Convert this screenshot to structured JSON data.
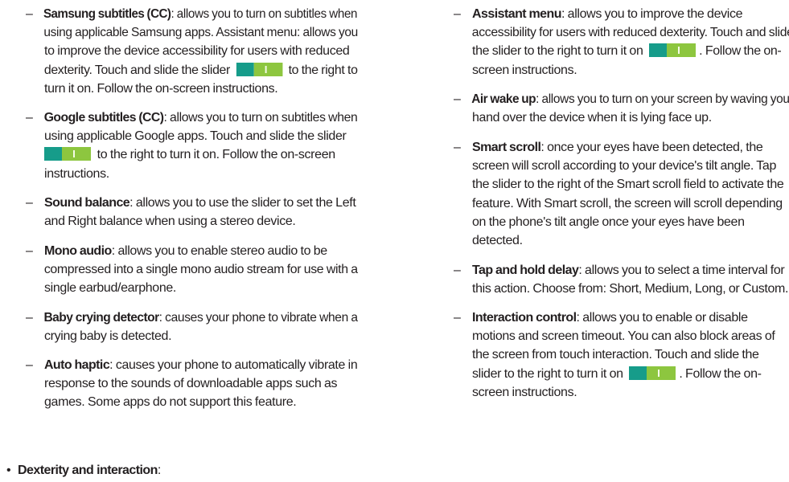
{
  "left": {
    "samsung": {
      "term": "Samsung subtitles (CC)",
      "l1_rest": ": allows you to turn on subtitles when",
      "l2": "using applicable Samsung apps. Assistant menu: allows you",
      "l3": "to improve the device accessibility for users with reduced",
      "l4_a": "dexterity. Touch and slide the slider",
      "l4_b": "to the right to",
      "l5": "turn it on. Follow the on-screen instructions."
    },
    "google": {
      "term": "Google subtitles (CC)",
      "l1_rest": ": allows you to turn on subtitles when",
      "l2": "using applicable Google apps. Touch and slide the slider",
      "l3_b": "to the right to turn it on. Follow the on-screen",
      "l4": "instructions."
    },
    "sound": {
      "term": "Sound balance",
      "l1_rest": ": allows you to use the slider to set the Left",
      "l2": "and Right balance when using a stereo device."
    },
    "mono": {
      "term": "Mono audio",
      "l1_rest": ": allows you to enable stereo audio to be",
      "l2": "compressed into a single mono audio stream for use with a",
      "l3": "single earbud/earphone."
    },
    "baby": {
      "term": "Baby crying detector",
      "l1_rest": ": causes your phone to vibrate when a",
      "l2": "crying baby is detected."
    },
    "haptic": {
      "term": "Auto haptic",
      "l1_rest": ": causes your phone to automatically vibrate in",
      "l2": "response to the sounds of downloadable apps such as",
      "l3": "games. Some apps do not support this feature."
    },
    "dexterity": {
      "bullet": "•",
      "term": "Dexterity and interaction",
      "rest": ":"
    }
  },
  "right": {
    "assistant": {
      "term": "Assistant menu",
      "l1_rest": ": allows you to improve the device",
      "l2": "accessibility for users with reduced dexterity. Touch and slide",
      "l3_a": "the slider to the right to turn it on",
      "l3_b": ". Follow the on-",
      "l4": "screen instructions."
    },
    "airwake": {
      "term": "Air wake up",
      "l1_rest": ": allows you to turn on your screen by waving your",
      "l2": "hand over the device when it is lying face up."
    },
    "smart": {
      "term": "Smart scroll",
      "l1_rest": ": once your eyes have been detected, the",
      "l2": "screen will scroll according to your device's tilt angle. Tap",
      "l3": "the slider to the right of the Smart scroll field to activate the",
      "l4": "feature. With Smart scroll, the screen will scroll depending",
      "l5": "on the phone's tilt angle once your eyes have been",
      "l6": "detected."
    },
    "taphold": {
      "term": "Tap and hold delay",
      "l1_rest": ": allows you to select a time interval for",
      "l2": "this action. Choose from: Short, Medium, Long, or Custom."
    },
    "interaction": {
      "term": "Interaction control",
      "l1_rest": ": allows you to enable or disable",
      "l2": "motions and screen timeout. You can also block areas of",
      "l3": "the screen from touch interaction. Touch and slide the",
      "l4_a": "slider to the right to turn it on",
      "l4_b": ". Follow the on-",
      "l5": "screen instructions."
    }
  },
  "dash": "–",
  "colors": {
    "text": "#231f20",
    "toggle_dark": "#169c8a",
    "toggle_light": "#8dc63f"
  },
  "icons": {
    "toggle": "toggle-switch-icon"
  }
}
